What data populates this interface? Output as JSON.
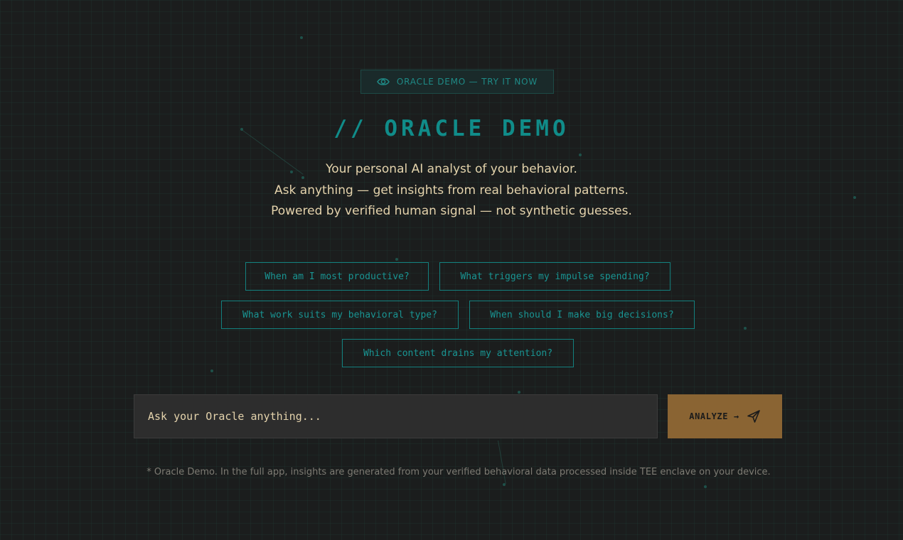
{
  "badge": {
    "icon": "eye-icon",
    "label": "ORACLE DEMO — TRY IT NOW"
  },
  "title": "// ORACLE DEMO",
  "subtitle_lines": [
    "Your personal AI analyst of your behavior.",
    "Ask anything — get insights from real behavioral patterns.",
    "Powered by verified human signal — not synthetic guesses."
  ],
  "suggestions": [
    "When am I most productive?",
    "What triggers my impulse spending?",
    "What work suits my behavioral type?",
    "When should I make big decisions?",
    "Which content drains my attention?"
  ],
  "ask": {
    "placeholder": "Ask your Oracle anything...",
    "value": ""
  },
  "analyze_button": {
    "label": "ANALYZE →",
    "icon": "send-icon"
  },
  "footnote": "* Oracle Demo. In the full app, insights are generated from your verified behavioral data processed inside TEE enclave on your device.",
  "colors": {
    "background": "#1b1d1d",
    "accent_teal": "#108c89",
    "text_cream": "#e4d3ac",
    "button_amber": "#8a6433",
    "muted": "#7d7b73"
  }
}
